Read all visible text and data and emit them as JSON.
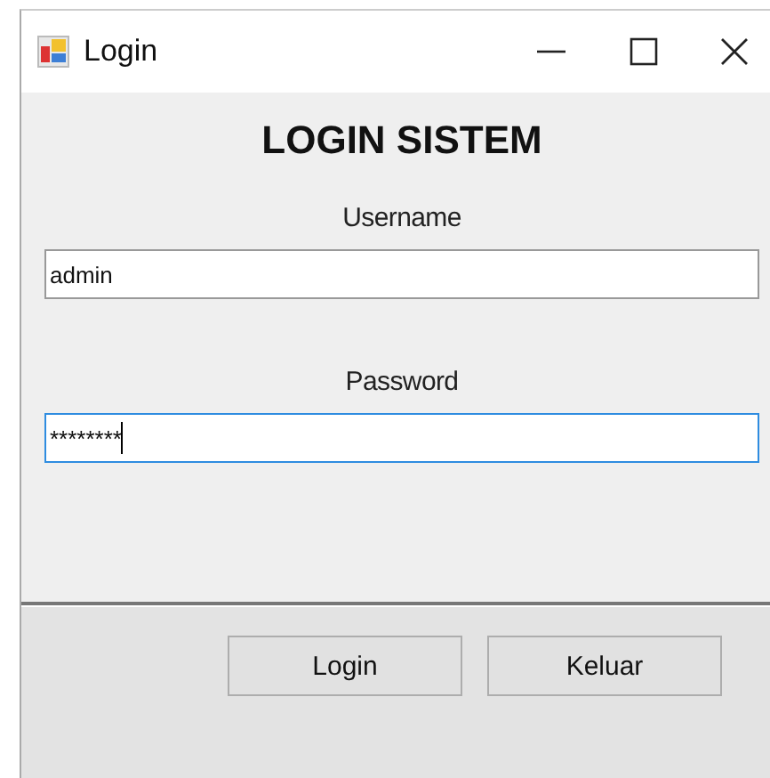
{
  "window": {
    "title": "Login"
  },
  "heading": "LOGIN SISTEM",
  "fields": [
    {
      "label": "Username",
      "value": "admin",
      "focused": false
    },
    {
      "label": "Password",
      "value": "********",
      "focused": true
    }
  ],
  "buttons": [
    "Login",
    "Keluar"
  ]
}
